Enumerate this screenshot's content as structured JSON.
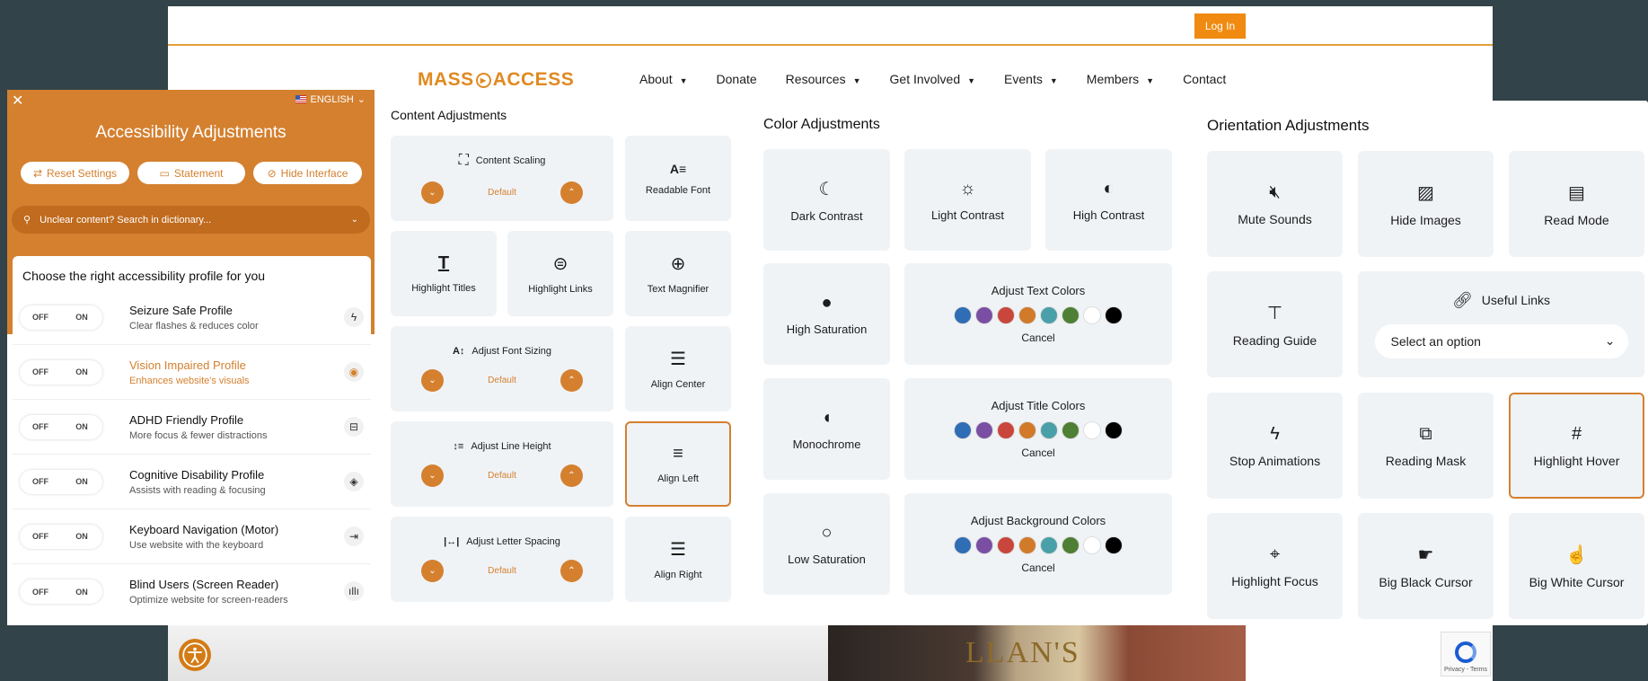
{
  "site": {
    "login_label": "Log In",
    "logo_text_1": "MASS",
    "logo_text_2": "ACCESS",
    "nav": [
      "About",
      "Donate",
      "Resources",
      "Get Involved",
      "Events",
      "Members",
      "Contact"
    ],
    "photo_text": "LLAN'S",
    "recaptcha": "Privacy - Terms"
  },
  "left_panel": {
    "language": "ENGLISH",
    "title": "Accessibility Adjustments",
    "buttons": [
      "Reset Settings",
      "Statement",
      "Hide Interface"
    ],
    "search_placeholder": "Unclear content? Search in dictionary...",
    "profiles_heading": "Choose the right accessibility profile for you",
    "toggle_off": "OFF",
    "toggle_on": "ON",
    "profiles": [
      {
        "title": "Seizure Safe Profile",
        "sub": "Clear flashes & reduces color",
        "icon": "bolt-icon"
      },
      {
        "title": "Vision Impaired Profile",
        "sub": "Enhances website's visuals",
        "icon": "eye-icon"
      },
      {
        "title": "ADHD Friendly Profile",
        "sub": "More focus & fewer distractions",
        "icon": "focus-box-icon"
      },
      {
        "title": "Cognitive Disability Profile",
        "sub": "Assists with reading & focusing",
        "icon": "target-icon"
      },
      {
        "title": "Keyboard Navigation (Motor)",
        "sub": "Use website with the keyboard",
        "icon": "arrow-tab-icon"
      },
      {
        "title": "Blind Users (Screen Reader)",
        "sub": "Optimize website for screen-readers",
        "icon": "audio-wave-icon"
      }
    ]
  },
  "content": {
    "title": "Content Adjustments",
    "default_label": "Default",
    "content_scaling": "Content Scaling",
    "readable_font": "Readable Font",
    "highlight_titles": "Highlight Titles",
    "highlight_links": "Highlight Links",
    "text_magnifier": "Text Magnifier",
    "adjust_font_sizing": "Adjust Font Sizing",
    "align_center": "Align Center",
    "adjust_line_height": "Adjust Line Height",
    "align_left": "Align Left",
    "adjust_letter_spacing": "Adjust Letter Spacing",
    "align_right": "Align Right"
  },
  "color": {
    "title": "Color Adjustments",
    "dark_contrast": "Dark Contrast",
    "light_contrast": "Light Contrast",
    "high_contrast": "High Contrast",
    "high_saturation": "High Saturation",
    "monochrome": "Monochrome",
    "low_saturation": "Low Saturation",
    "adjust_text_colors": "Adjust Text Colors",
    "adjust_title_colors": "Adjust Title Colors",
    "adjust_background_colors": "Adjust Background Colors",
    "cancel": "Cancel",
    "swatches": [
      "#2f6db5",
      "#7a4fa3",
      "#c8463b",
      "#d07a2a",
      "#4aa0a8",
      "#4e7f35",
      "#ffffff",
      "#000000"
    ]
  },
  "orientation": {
    "title": "Orientation Adjustments",
    "mute_sounds": "Mute Sounds",
    "hide_images": "Hide Images",
    "read_mode": "Read Mode",
    "reading_guide": "Reading Guide",
    "useful_links": "Useful Links",
    "select_placeholder": "Select an option",
    "stop_animations": "Stop Animations",
    "reading_mask": "Reading Mask",
    "highlight_hover": "Highlight Hover",
    "highlight_focus": "Highlight Focus",
    "big_black_cursor": "Big Black Cursor",
    "big_white_cursor": "Big White Cursor"
  },
  "colors": {
    "accent": "#d4802f",
    "tile_bg": "#f0f3f6",
    "backdrop": "#33434a"
  }
}
